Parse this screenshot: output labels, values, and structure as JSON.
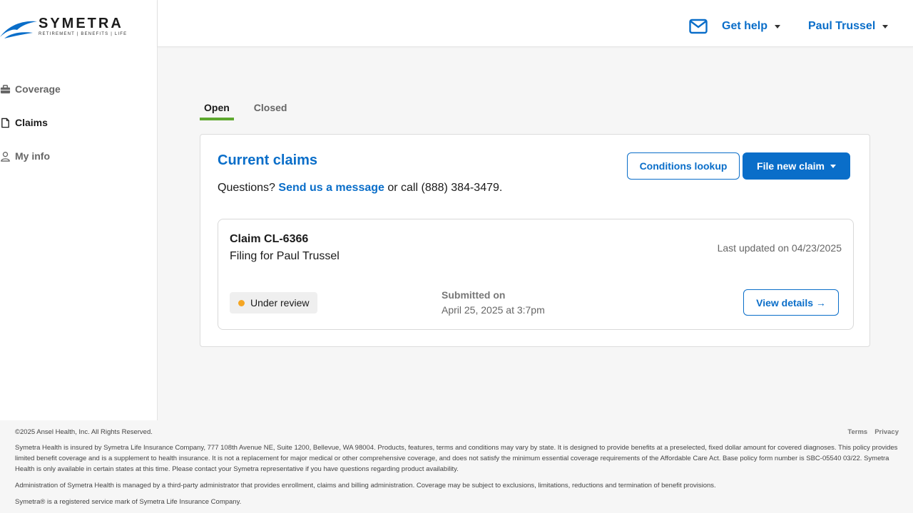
{
  "brand": {
    "name": "SYMETRA",
    "tagline": "RETIREMENT | BENEFITS | LIFE",
    "accent": "#0a6ec9",
    "tab_underline": "#5ea82f",
    "status_dot": "#f5a623"
  },
  "sidebar": {
    "items": [
      {
        "label": "Coverage",
        "icon": "briefcase-icon"
      },
      {
        "label": "Claims",
        "icon": "document-icon"
      },
      {
        "label": "My info",
        "icon": "user-icon"
      }
    ]
  },
  "header": {
    "mail_icon": "mail-icon",
    "help_label": "Get help",
    "user_label": "Paul Trussel"
  },
  "tabs": [
    {
      "label": "Open"
    },
    {
      "label": "Closed"
    }
  ],
  "claims_card": {
    "title": "Current claims",
    "questions_prefix": "Questions?",
    "message_link": "Send us a message",
    "questions_suffix": "or call (888) 384-3479.",
    "conditions_button": "Conditions lookup",
    "file_button": "File new claim"
  },
  "claim": {
    "id": "Claim CL-6366",
    "filing_for": "Filing for Paul Trussel",
    "last_updated": "Last updated on 04/23/2025",
    "status": "Under review",
    "submitted_label": "Submitted on",
    "submitted_value": "April 25, 2025 at 3:7pm",
    "details_button": "View details →"
  },
  "footer": {
    "copyright": "©2025 Ansel Health, Inc. All Rights Reserved.",
    "links": [
      "Terms",
      "Privacy"
    ],
    "disclaimer_1": "Symetra Health is insured by Symetra Life Insurance Company, 777 108th Avenue NE, Suite 1200, Bellevue, WA 98004. Products, features, terms and conditions may vary by state. It is designed to provide benefits at a preselected, fixed dollar amount for covered diagnoses. This policy provides limited benefit coverage and is a supplement to health insurance. It is not a replacement for major medical or other comprehensive coverage, and does not satisfy the minimum essential coverage requirements of the Affordable Care Act. Base policy form number is SBC-05540 03/22. Symetra Health is only available in certain states at this time. Please contact your Symetra representative if you have questions regarding product availability.",
    "disclaimer_2": "Administration of Symetra Health is managed by a third-party administrator that provides enrollment, claims and billing administration. Coverage may be subject to exclusions, limitations, reductions and termination of benefit provisions.",
    "disclaimer_3": "Symetra® is a registered service mark of Symetra Life Insurance Company."
  }
}
